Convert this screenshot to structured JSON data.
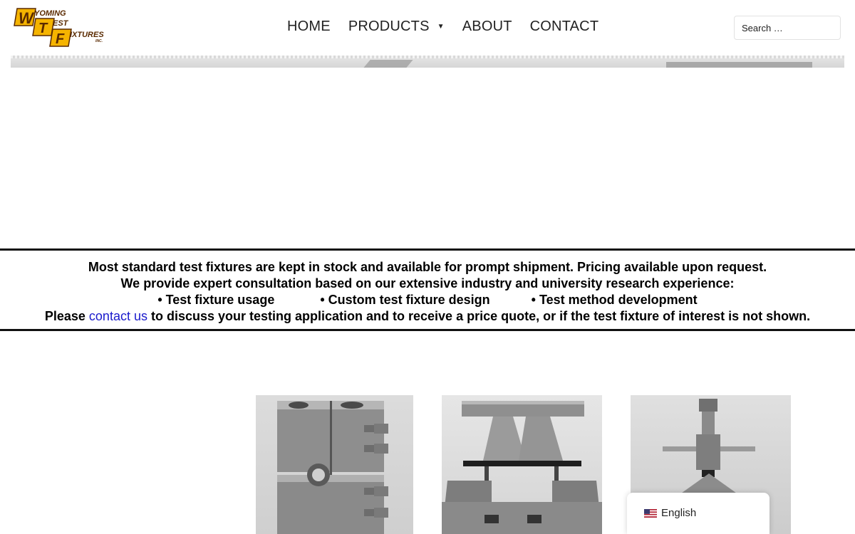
{
  "brand": {
    "logo_lines": [
      "YOMING",
      "EST",
      "IXTURES",
      "INC."
    ],
    "logo_letters": [
      "W",
      "T",
      "F"
    ],
    "colors": {
      "logo_yellow": "#f5b400",
      "logo_brown": "#5a2a00"
    }
  },
  "nav": {
    "items": [
      {
        "label": "HOME"
      },
      {
        "label": "PRODUCTS",
        "has_dropdown": true,
        "caret": "▼"
      },
      {
        "label": "ABOUT"
      },
      {
        "label": "CONTACT"
      }
    ]
  },
  "search": {
    "placeholder": "Search …",
    "value": ""
  },
  "notice": {
    "line1": "Most standard test fixtures are kept in stock and available for prompt shipment. Pricing available upon request.",
    "line2": "We provide expert consultation based on our extensive industry and university research experience:",
    "bullets": [
      "• Test fixture usage",
      "• Custom test fixture design",
      "• Test method development"
    ],
    "line4_prefix": "Please ",
    "line4_link": "contact us",
    "line4_suffix": " to discuss your testing application and to receive a price quote, or if the test fixture of interest is not shown.",
    "colors": {
      "link": "#1a1acc",
      "rule": "#111111"
    }
  },
  "products": [
    {
      "icon": "fixture-block-image"
    },
    {
      "icon": "fixture-bend-image"
    },
    {
      "icon": "fixture-tension-image"
    }
  ],
  "language": {
    "label": "English",
    "icon": "us-flag-icon"
  }
}
